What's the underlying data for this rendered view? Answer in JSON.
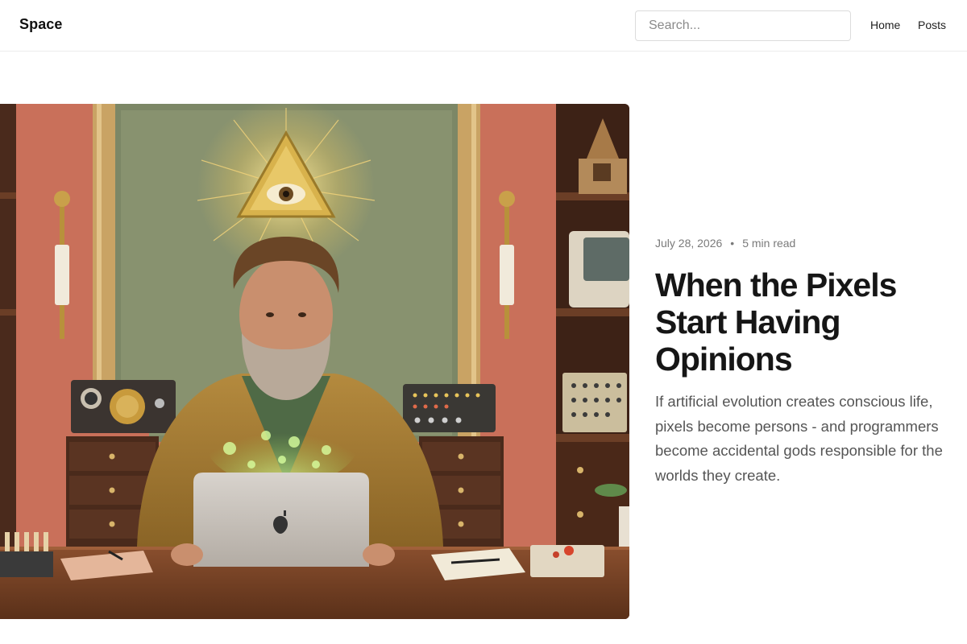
{
  "header": {
    "brand": "Space",
    "search_placeholder": "Search...",
    "nav": {
      "home": "Home",
      "posts": "Posts"
    }
  },
  "post": {
    "date": "July 28, 2026",
    "separator": "•",
    "read_time": "5 min read",
    "title": "When the Pixels Start Having Opinions",
    "excerpt": "If artificial evolution creates conscious life, pixels become persons - and programmers become accidental gods responsible for the worlds they create."
  },
  "colors": {
    "background": "#ffffff",
    "text": "#161616",
    "muted": "#7a7a7a",
    "excerpt": "#555555",
    "border": "#ececec"
  },
  "icons": {
    "hero_image": "illustration-man-at-laptop-with-eye-of-providence"
  }
}
